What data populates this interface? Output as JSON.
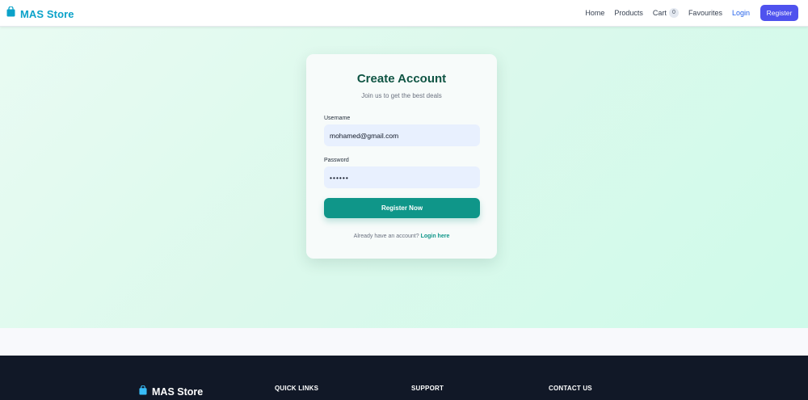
{
  "brand": {
    "name": "MAS Store",
    "color": "#0ba2c9",
    "icon": "shopping-bag-icon"
  },
  "nav": {
    "home": "Home",
    "products": "Products",
    "cart": "Cart",
    "cart_count": "0",
    "favourites": "Favourites",
    "login": "Login",
    "register": "Register"
  },
  "form": {
    "title": "Create Account",
    "subtitle": "Join us to get the best deals",
    "username_label": "Username",
    "username_value": "mohamed@gmail.com",
    "password_label": "Password",
    "password_value": "••••••",
    "submit_label": "Register Now",
    "login_prompt": "Already have an account?",
    "login_link": "Login here"
  },
  "footer": {
    "brand": "MAS Store",
    "quick_links": "QUICK LINKS",
    "support": "SUPPORT",
    "contact": "CONTACT US"
  },
  "colors": {
    "primary": "#0f9689",
    "register_button": "#4f52ee",
    "title": "#0f5443",
    "footer_bg": "#111827"
  }
}
